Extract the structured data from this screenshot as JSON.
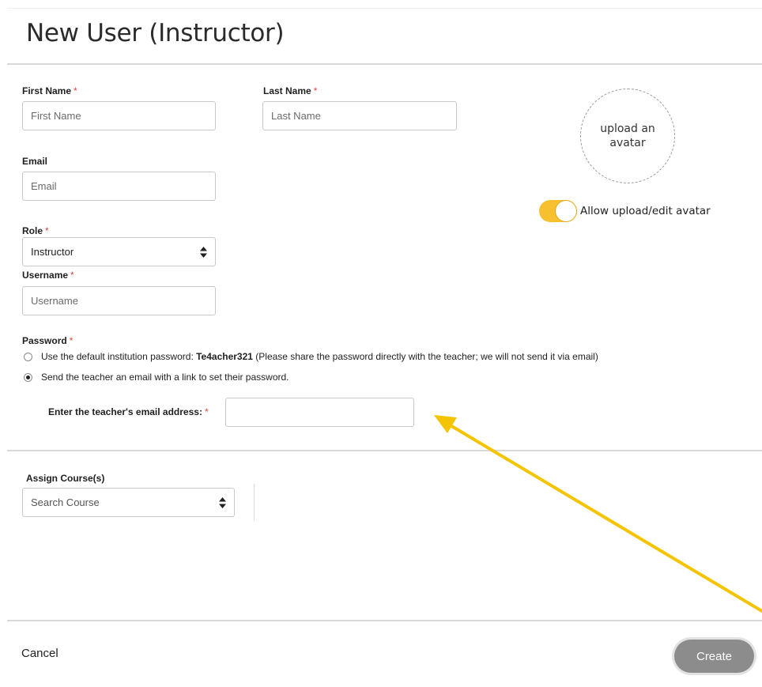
{
  "header": {
    "title": "New User (Instructor)"
  },
  "form": {
    "required_mark": "*",
    "first_name": {
      "label": "First Name",
      "placeholder": "First Name"
    },
    "last_name": {
      "label": "Last Name",
      "placeholder": "Last Name"
    },
    "email": {
      "label": "Email",
      "placeholder": "Email"
    },
    "role": {
      "label": "Role",
      "value": "Instructor"
    },
    "username": {
      "label": "Username",
      "placeholder": "Username"
    },
    "password": {
      "label": "Password",
      "option_default_prefix": "Use the default institution password: ",
      "default_password": "Te4acher321",
      "option_default_suffix": " (Please share the password directly with the teacher; we will not send it via email)",
      "option_email": "Send the teacher an email with a link to set their password.",
      "selected": "email",
      "teacher_email_label": "Enter the teacher's email address:",
      "teacher_email_value": ""
    }
  },
  "avatar": {
    "upload_text": "upload an avatar",
    "toggle_label": "Allow upload/edit avatar",
    "toggle_on": true,
    "toggle_color": "#f7c02e"
  },
  "courses": {
    "label": "Assign Course(s)",
    "placeholder": "Search Course"
  },
  "footer": {
    "cancel_label": "Cancel",
    "create_label": "Create"
  },
  "annotation": {
    "arrow_color": "#f5c400",
    "arrow_icon": "annotation-arrow"
  }
}
